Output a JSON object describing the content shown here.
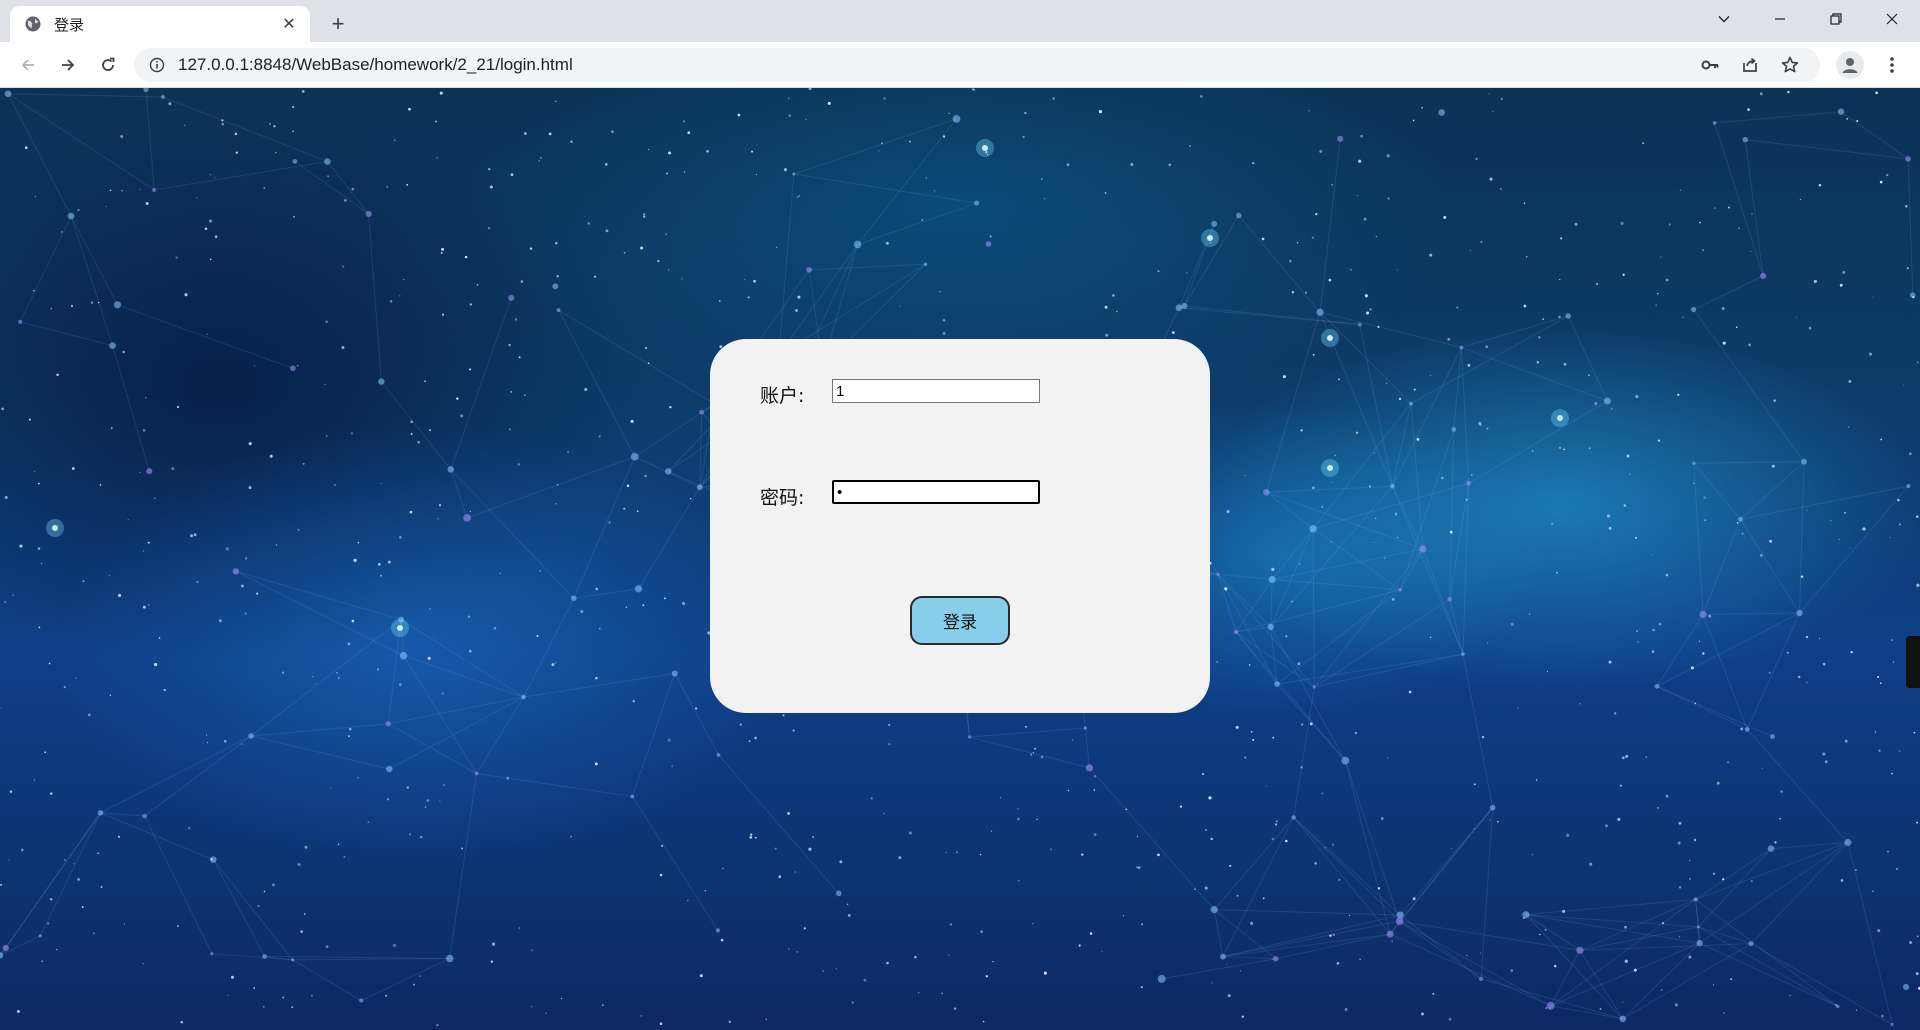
{
  "browser": {
    "tab": {
      "title": "登录",
      "favicon": "globe-icon",
      "close": "✕"
    },
    "new_tab": "+",
    "address": "127.0.0.1:8848/WebBase/homework/2_21/login.html",
    "window_controls": [
      "chevron-down-icon",
      "minimize-icon",
      "restore-icon",
      "close-icon"
    ]
  },
  "login": {
    "account_label": "账户:",
    "account_value": "1",
    "password_label": "密码:",
    "password_value": "•",
    "submit_label": "登录"
  },
  "colors": {
    "card_bg": "#f2f2f3",
    "button_bg": "#87ceeb",
    "page_bg": "#0f3f86"
  }
}
